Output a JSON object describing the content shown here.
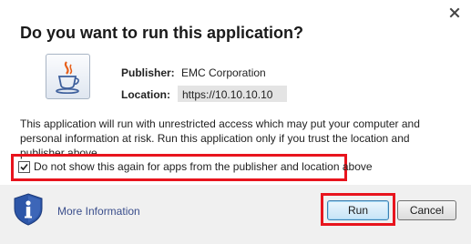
{
  "dialog": {
    "title": "Do you want to run this application?",
    "close_icon": "close-icon",
    "app_icon": "java-icon"
  },
  "fields": {
    "publisher_label": "Publisher:",
    "publisher_value": "EMC Corporation",
    "location_label": "Location:",
    "location_value": "https://10.10.10.10"
  },
  "warning_text": "This application will run with unrestricted access which may put your computer and personal information at risk. Run this application only if you trust the location and publisher above.",
  "checkbox": {
    "label": "Do not show this again for apps from the publisher and location above",
    "checked": true
  },
  "footer": {
    "info_icon": "shield-info-icon",
    "more_info_label": "More Information",
    "run_label": "Run",
    "cancel_label": "Cancel"
  },
  "colors": {
    "highlight": "#e8141d",
    "link": "#3a4e8c",
    "shield": "#2d56a8"
  }
}
